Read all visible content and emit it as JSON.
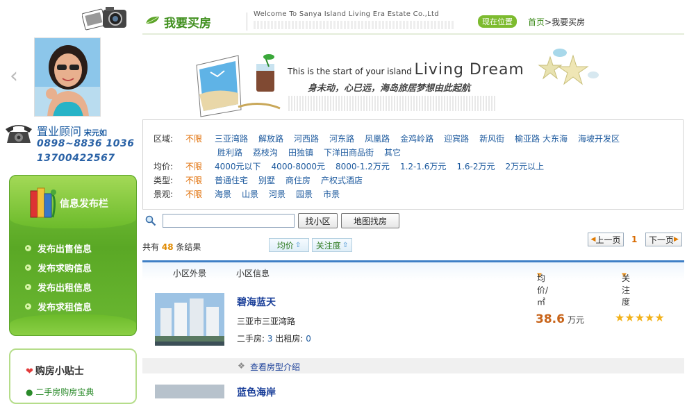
{
  "sidebar": {
    "consultant_title": "置业顾问",
    "consultant_name": "宋元如",
    "phone1": "0898~8836 1036",
    "phone2": "13700422567",
    "info_title": "信息发布栏",
    "info_items": [
      "发布出售信息",
      "发布求购信息",
      "发布出租信息",
      "发布求租信息"
    ],
    "tips_title": "购房小贴士",
    "tips_item": "二手房购房宝典"
  },
  "header": {
    "page_title": "我要买房",
    "welcome": "Welcome To Sanya Island Living Era Estate Co.,Ltd",
    "location_label": "现在位置",
    "breadcrumb_home": "首页",
    "breadcrumb_sep": ">",
    "breadcrumb_current": "我要买房"
  },
  "banner": {
    "slogan_small": "This is the start of your island",
    "slogan_big": "Living Dream",
    "slogan_cn": "身未动，心已远，海岛旅居梦想由此起航"
  },
  "filters": {
    "area_label": "区域:",
    "unlimited": "不限",
    "areas_line1": [
      "三亚湾路",
      "解放路",
      "河西路",
      "河东路",
      "凤凰路",
      "金鸡岭路",
      "迎宾路",
      "新风街",
      "榆亚路 大东海",
      "海坡开发区"
    ],
    "areas_line2": [
      "胜利路",
      "荔枝沟",
      "田独镇",
      "下洋田商品街",
      "其它"
    ],
    "price_label": "均价:",
    "prices": [
      "4000元以下",
      "4000-8000元",
      "8000-1.2万元",
      "1.2-1.6万元",
      "1.6-2万元",
      "2万元以上"
    ],
    "type_label": "类型:",
    "types": [
      "普通住宅",
      "别墅",
      "商住房",
      "产权式酒店"
    ],
    "view_label": "景观:",
    "views": [
      "海景",
      "山景",
      "河景",
      "园景",
      "市景"
    ]
  },
  "search": {
    "placeholder": "",
    "find_button": "找小区",
    "map_button": "地图找房"
  },
  "results": {
    "prefix": "共有",
    "count": "48",
    "suffix": "条结果",
    "sort_price": "均价",
    "sort_attention": "关注度",
    "prev": "上一页",
    "page": "1",
    "next": "下一页"
  },
  "table": {
    "col_exterior": "小区外景",
    "col_info": "小区信息",
    "col_price": "均价/㎡",
    "col_attention": "关注度"
  },
  "listings": [
    {
      "name": "碧海蓝天",
      "address": "三亚市三亚湾路",
      "second_hand_label": "二手房:",
      "second_hand": "3",
      "rent_label": "出租房:",
      "rent": "0",
      "price": "38.6",
      "price_unit": "万元",
      "stars": "★★★★★",
      "floorplan_link": "查看房型介绍"
    },
    {
      "name": "蓝色海岸"
    }
  ],
  "colors": {
    "accent_green": "#3f8f1d",
    "link_blue": "#1d5a9e",
    "price_orange": "#c8641a",
    "table_blue": "#3f7fc6"
  }
}
